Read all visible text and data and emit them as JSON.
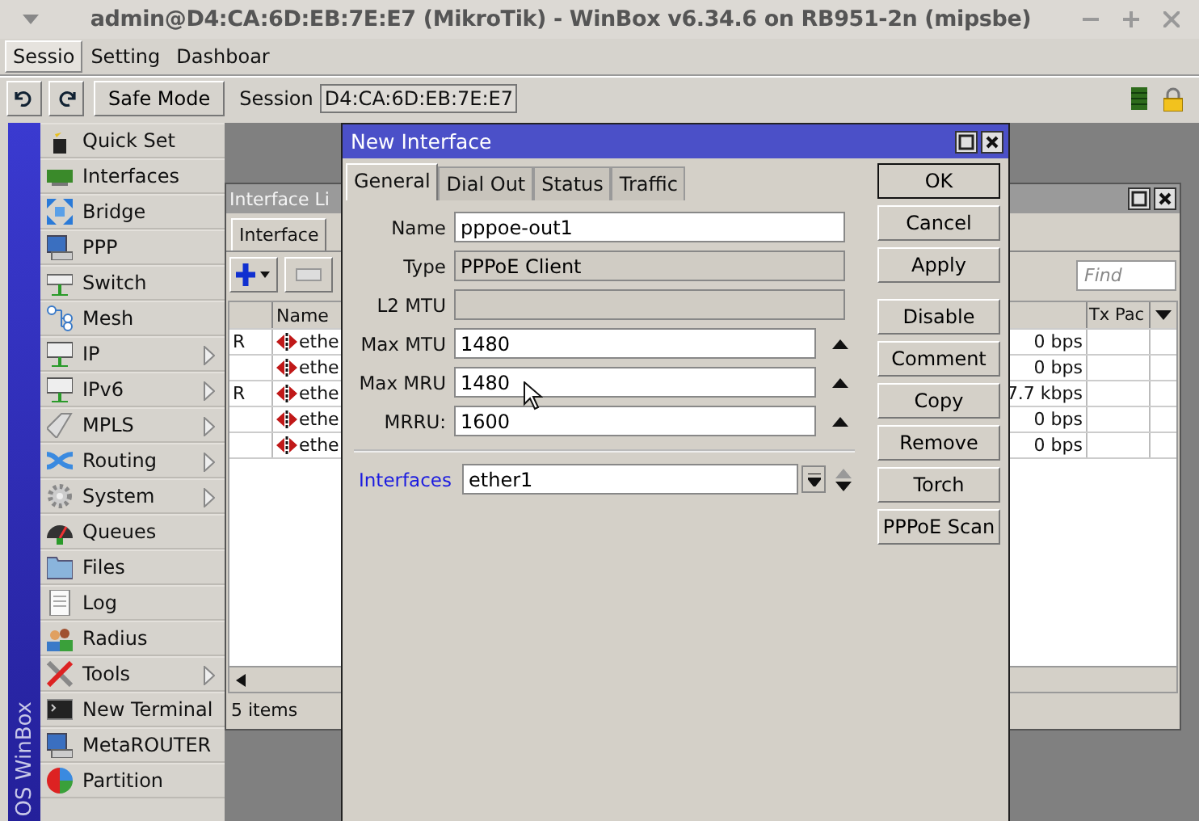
{
  "window": {
    "title": "admin@D4:CA:6D:EB:7E:E7 (MikroTik) - WinBox v6.34.6 on RB951-2n (mipsbe)"
  },
  "menu_bar": [
    {
      "label": "Sessio",
      "selected": true
    },
    {
      "label": "Setting",
      "selected": false
    },
    {
      "label": "Dashboar",
      "selected": false
    }
  ],
  "toolbar": {
    "safe_mode": "Safe Mode",
    "session_label": "Session",
    "session_value": "D4:CA:6D:EB:7E:E7"
  },
  "sidebar": {
    "brand": "OS WinBox",
    "items": [
      {
        "label": "Quick Set",
        "submenu": false
      },
      {
        "label": "Interfaces",
        "submenu": false
      },
      {
        "label": "Bridge",
        "submenu": false
      },
      {
        "label": "PPP",
        "submenu": false
      },
      {
        "label": "Switch",
        "submenu": false
      },
      {
        "label": "Mesh",
        "submenu": false
      },
      {
        "label": "IP",
        "submenu": true
      },
      {
        "label": "IPv6",
        "submenu": true
      },
      {
        "label": "MPLS",
        "submenu": true
      },
      {
        "label": "Routing",
        "submenu": true
      },
      {
        "label": "System",
        "submenu": true
      },
      {
        "label": "Queues",
        "submenu": false
      },
      {
        "label": "Files",
        "submenu": false
      },
      {
        "label": "Log",
        "submenu": false
      },
      {
        "label": "Radius",
        "submenu": false
      },
      {
        "label": "Tools",
        "submenu": true
      },
      {
        "label": "New Terminal",
        "submenu": false
      },
      {
        "label": "MetaROUTER",
        "submenu": false
      },
      {
        "label": "Partition",
        "submenu": false
      }
    ]
  },
  "interface_list": {
    "title": "Interface Li",
    "tabs": [
      {
        "label": "Interface",
        "selected": true
      }
    ],
    "find": {
      "placeholder": "Find"
    },
    "columns": [
      "Name",
      "Tx Pac"
    ],
    "rows": [
      {
        "flag": "R",
        "name": "ethe",
        "rate": "0 bps"
      },
      {
        "name": "ethe",
        "rate": "0 bps"
      },
      {
        "flag": "R",
        "name": "ethe",
        "rate": "7.7 kbps"
      },
      {
        "name": "ethe",
        "rate": "0 bps"
      },
      {
        "name": "ethe",
        "rate": "0 bps"
      }
    ],
    "status": "5 items"
  },
  "dialog": {
    "title": "New Interface",
    "tabs": [
      {
        "label": "General",
        "selected": true
      },
      {
        "label": "Dial Out",
        "selected": false
      },
      {
        "label": "Status",
        "selected": false
      },
      {
        "label": "Traffic",
        "selected": false
      }
    ],
    "fields": [
      {
        "label": "Name",
        "value": "pppoe-out1",
        "kind": "text",
        "disabled": false
      },
      {
        "label": "Type",
        "value": "PPPoE Client",
        "kind": "text",
        "disabled": true
      },
      {
        "label": "L2 MTU",
        "kind": "text",
        "disabled": true
      },
      {
        "label": "Max MTU",
        "value": "1480",
        "kind": "spin",
        "disabled": false
      },
      {
        "label": "Max MRU",
        "value": "1480",
        "kind": "spin",
        "disabled": false
      },
      {
        "label": "MRRU:",
        "value": "1600",
        "kind": "spin",
        "disabled": false
      },
      {
        "label": "Interfaces",
        "value": "ether1",
        "kind": "dropdown",
        "disabled": false,
        "link": true
      }
    ],
    "button_groups": [
      [
        {
          "label": "OK",
          "default": true
        },
        {
          "label": "Cancel",
          "default": false
        },
        {
          "label": "Apply",
          "default": false
        }
      ],
      [
        {
          "label": "Disable",
          "default": false
        },
        {
          "label": "Comment",
          "default": false
        },
        {
          "label": "Copy",
          "default": false
        },
        {
          "label": "Remove",
          "default": false
        },
        {
          "label": "Torch",
          "default": false
        },
        {
          "label": "PPPoE Scan",
          "default": false
        }
      ]
    ]
  }
}
